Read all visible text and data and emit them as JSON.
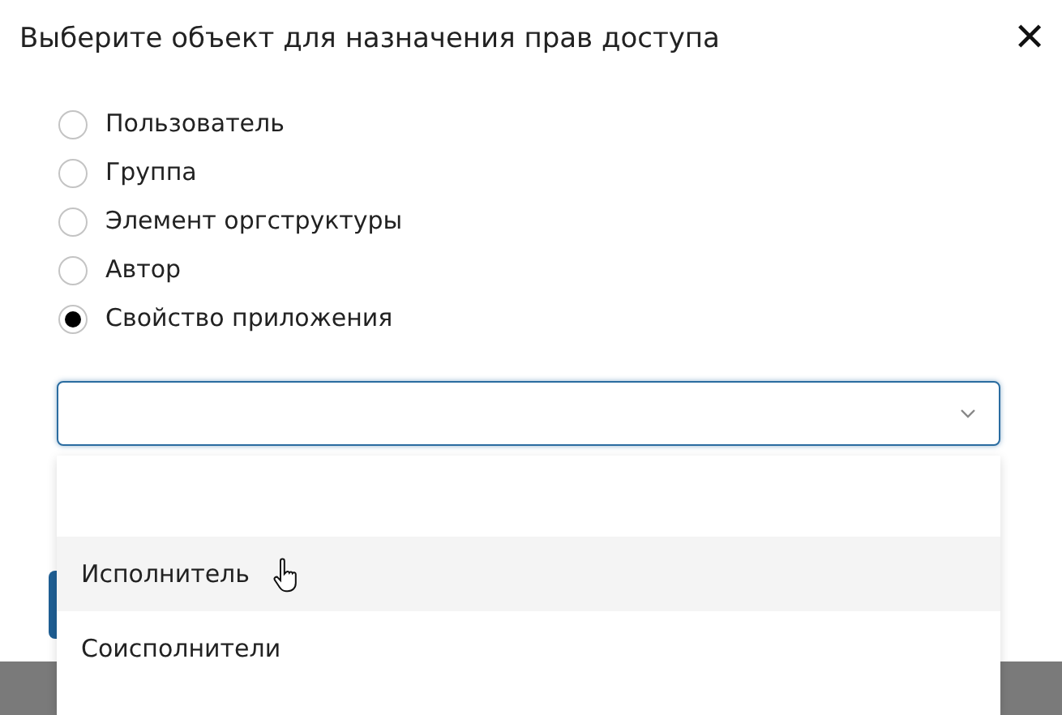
{
  "dialog": {
    "title": "Выберите объект для назначения прав доступа",
    "close": "✕"
  },
  "options": [
    {
      "label": "Пользователь",
      "selected": false
    },
    {
      "label": "Группа",
      "selected": false
    },
    {
      "label": "Элемент оргструктуры",
      "selected": false
    },
    {
      "label": "Автор",
      "selected": false
    },
    {
      "label": "Свойство приложения",
      "selected": true
    }
  ],
  "select": {
    "expanded": true
  },
  "dropdown_items": [
    {
      "label": "Исполнитель",
      "highlighted": true
    },
    {
      "label": "Соисполнители",
      "highlighted": false
    }
  ]
}
